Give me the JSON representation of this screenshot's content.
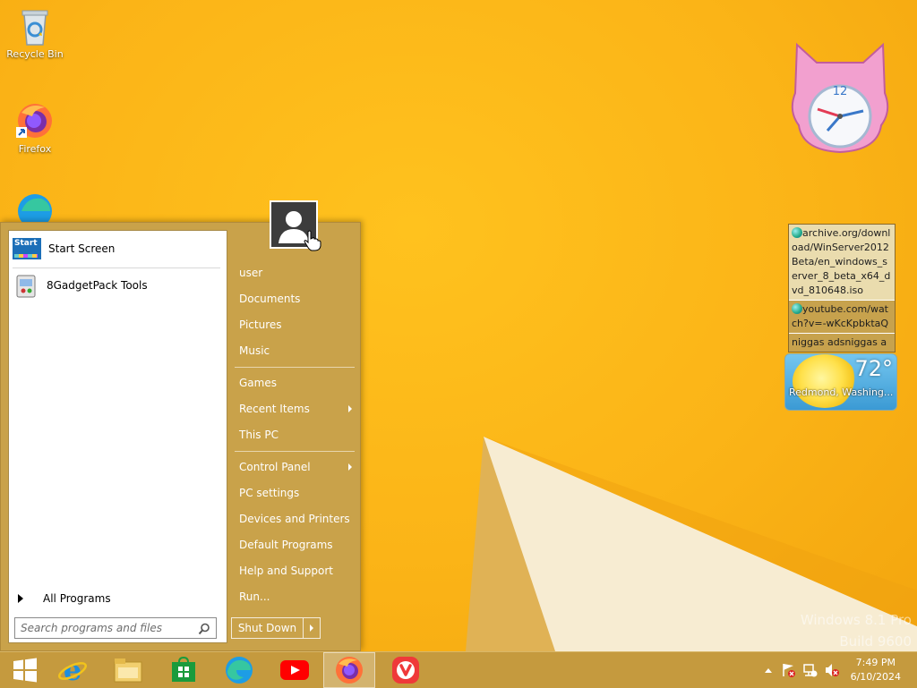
{
  "desktop": {
    "watermark_line1": "Windows 8.1 Pro",
    "watermark_line2": "Build 9600",
    "icons": [
      {
        "label": "Recycle Bin",
        "icon": "recycle-bin-icon"
      },
      {
        "label": "Firefox",
        "icon": "firefox-icon"
      },
      {
        "label": "",
        "icon": "edge-icon"
      }
    ]
  },
  "start_menu": {
    "programs": [
      {
        "label": "Start Screen",
        "icon": "start-screen-icon",
        "icon_text": "Start"
      },
      {
        "label": "8GadgetPack Tools",
        "icon": "gadgetpack-icon"
      }
    ],
    "all_programs_label": "All Programs",
    "search_placeholder": "Search programs and files",
    "right_items": [
      {
        "label": "user"
      },
      {
        "label": "Documents"
      },
      {
        "label": "Pictures"
      },
      {
        "label": "Music"
      },
      {
        "label": "Games"
      },
      {
        "label": "Recent Items",
        "submenu": true
      },
      {
        "label": "This PC"
      },
      {
        "label": "Control Panel",
        "submenu": true
      },
      {
        "label": "PC settings"
      },
      {
        "label": "Devices and Printers"
      },
      {
        "label": "Default Programs"
      },
      {
        "label": "Help and Support"
      },
      {
        "label": "Run..."
      }
    ],
    "shutdown_label": "Shut Down"
  },
  "gadgets": {
    "clock": {
      "numeral": "12"
    },
    "feed": [
      {
        "text": "archive.org/download/WinServer2012Beta/en_windows_server_8_beta_x64_dvd_810648.iso",
        "selected": true
      },
      {
        "text": "youtube.com/watch?v=-wKcKpbktaQ",
        "selected": false
      },
      {
        "text": "niggas adsniggas ads",
        "selected": false
      }
    ],
    "weather": {
      "temperature": "72°",
      "location": "Redmond, Washing..."
    }
  },
  "taskbar": {
    "apps": [
      {
        "name": "start-button",
        "icon": "windows-logo-icon"
      },
      {
        "name": "internet-explorer",
        "icon": "internet-explorer-icon"
      },
      {
        "name": "file-explorer",
        "icon": "file-explorer-icon"
      },
      {
        "name": "store",
        "icon": "store-icon"
      },
      {
        "name": "edge",
        "icon": "edge-icon"
      },
      {
        "name": "youtube",
        "icon": "youtube-icon"
      },
      {
        "name": "firefox",
        "icon": "firefox-icon",
        "active": true
      },
      {
        "name": "vivaldi",
        "icon": "vivaldi-icon"
      }
    ],
    "time": "7:49 PM",
    "date": "6/10/2024"
  }
}
